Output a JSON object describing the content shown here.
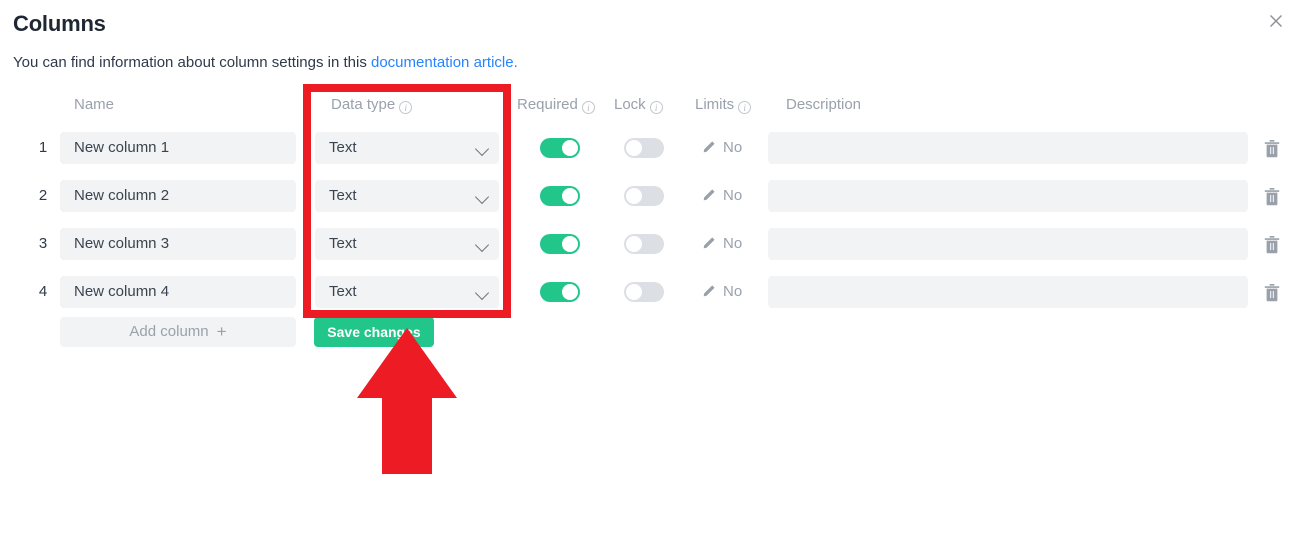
{
  "dialog": {
    "title": "Columns",
    "subtitle_prefix": "You can find information about column settings in this ",
    "subtitle_link": "documentation article.",
    "close_icon": "close-icon"
  },
  "table": {
    "headers": {
      "name": "Name",
      "data_type": "Data type",
      "required": "Required",
      "lock": "Lock",
      "limits": "Limits",
      "description": "Description"
    },
    "rows": [
      {
        "index": "1",
        "name": "New column 1",
        "data_type": "Text",
        "required": true,
        "lock": false,
        "limits": "No",
        "description": ""
      },
      {
        "index": "2",
        "name": "New column 2",
        "data_type": "Text",
        "required": true,
        "lock": false,
        "limits": "No",
        "description": ""
      },
      {
        "index": "3",
        "name": "New column 3",
        "data_type": "Text",
        "required": true,
        "lock": false,
        "limits": "No",
        "description": ""
      },
      {
        "index": "4",
        "name": "New column 4",
        "data_type": "Text",
        "required": true,
        "lock": false,
        "limits": "No",
        "description": ""
      }
    ]
  },
  "footer": {
    "add_column_label": "Add column",
    "add_column_plus": "+",
    "save_label": "Save changes"
  },
  "annotations": {
    "highlight_target": "data-type-column",
    "arrow_target": "save-changes-button",
    "color": "#ED1C24"
  },
  "colors": {
    "accent_green": "#22C68B",
    "link_blue": "#2684FF",
    "field_bg": "#F1F3F4",
    "toggle_off": "#DCDFE3",
    "muted_text": "#9AA1AC",
    "body_text": "#2E3A49",
    "annotation_red": "#ED1C24"
  }
}
